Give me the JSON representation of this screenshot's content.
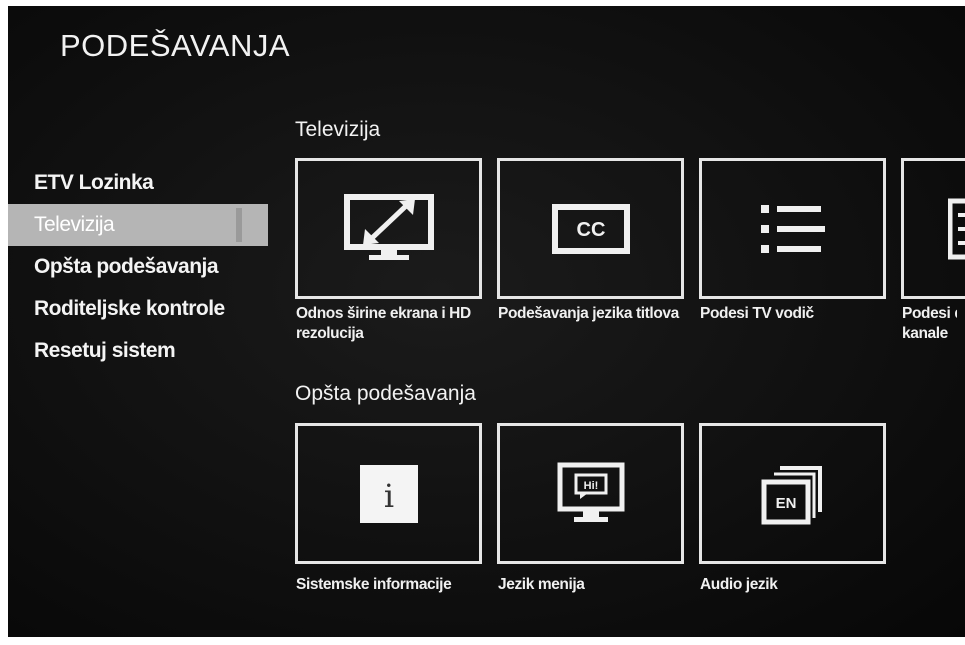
{
  "header": {
    "title": "PODEŠAVANJA"
  },
  "sidebar": {
    "items": [
      {
        "label": "ETV Lozinka"
      },
      {
        "label": "Televizija",
        "selected": true
      },
      {
        "label": "Opšta podešavanja"
      },
      {
        "label": "Roditeljske kontrole"
      },
      {
        "label": "Resetuj sistem"
      }
    ]
  },
  "sections": [
    {
      "title": "Televizija",
      "tiles": [
        {
          "label": "Odnos širine ekrana i HD rezolucija",
          "icon": "aspect-ratio-tv-icon"
        },
        {
          "label": "Podešavanja jezika titlova",
          "icon": "closed-captions-icon",
          "icon_text": "CC"
        },
        {
          "label": "Podesi TV vodič",
          "icon": "list-icon"
        },
        {
          "label": "Podesi d\nkanale",
          "icon": "channel-list-icon"
        }
      ]
    },
    {
      "title": "Opšta podešavanja",
      "tiles": [
        {
          "label": "Sistemske informacije",
          "icon": "info-icon",
          "icon_text": "i"
        },
        {
          "label": "Jezik menija",
          "icon": "menu-language-tv-icon",
          "icon_text": "Hi!"
        },
        {
          "label": "Audio jezik",
          "icon": "audio-language-icon",
          "icon_text": "EN"
        }
      ]
    }
  ],
  "colors": {
    "background": "#101010",
    "text": "#f2f2f2",
    "selected": "#b5b5b5",
    "tile_border": "#e6e6e6"
  }
}
